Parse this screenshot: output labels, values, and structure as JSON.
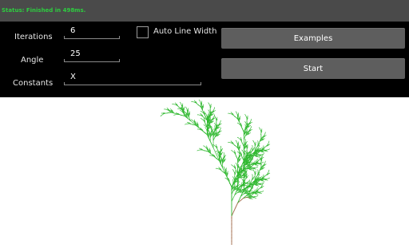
{
  "status": {
    "text": "Status: Finished in 498ms."
  },
  "form": {
    "iterations_label": "Iterations",
    "iterations_value": "6",
    "angle_label": "Angle",
    "angle_value": "25",
    "constants_label": "Constants",
    "constants_value": "X",
    "auto_line_width_label": "Auto Line Width",
    "auto_line_width_checked": false
  },
  "buttons": {
    "examples_label": "Examples",
    "start_label": "Start"
  },
  "colors": {
    "status_text": "#2ecc40",
    "status_bar": "#4a4a4a",
    "panel": "#000000",
    "button": "#5e5e5e",
    "leaf": "#2fb82f",
    "trunk": "#a06a4a"
  },
  "render": {
    "iterations": 6,
    "angle_deg": 25
  }
}
